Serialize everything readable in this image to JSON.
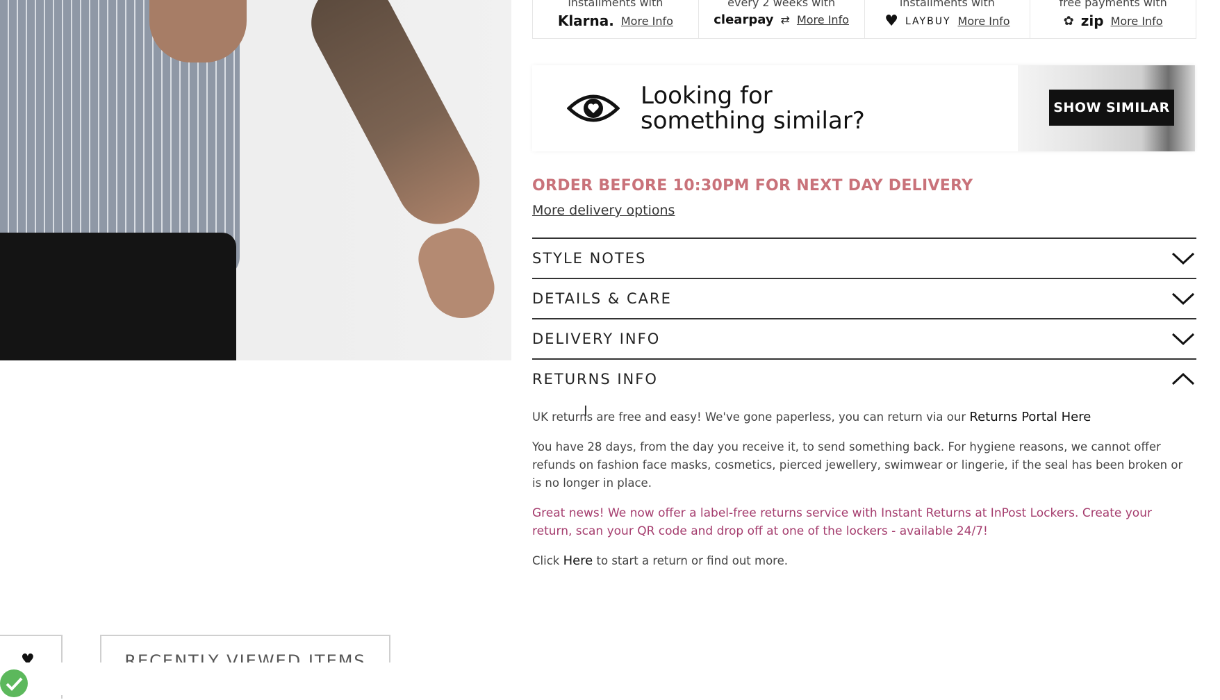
{
  "payments": [
    {
      "text": "installments with",
      "brand": "Klarna.",
      "more": "More Info"
    },
    {
      "text": "every 2 weeks with",
      "brand": "clearpay",
      "more": "More Info"
    },
    {
      "text": "installments with",
      "brand": "LAYBUY",
      "more": "More Info"
    },
    {
      "text": "free payments with",
      "brand": "zip",
      "more": "More Info"
    }
  ],
  "similar": {
    "title_line1": "Looking for",
    "title_line2": "something similar?",
    "button": "SHOW SIMILAR"
  },
  "delivery": {
    "notice": "ORDER BEFORE 10:30PM FOR NEXT DAY DELIVERY",
    "link": "More delivery options"
  },
  "accordion": [
    {
      "label": "STYLE NOTES",
      "state": "collapsed"
    },
    {
      "label": "DETAILS & CARE",
      "state": "collapsed"
    },
    {
      "label": "DELIVERY INFO",
      "state": "collapsed"
    },
    {
      "label": "RETURNS INFO",
      "state": "expanded"
    }
  ],
  "returns": {
    "p1_text": "UK returns are free and easy! We've gone paperless, you can return via our ",
    "p1_link": "Returns Portal Here",
    "p2": "You have 28 days, from the day you receive it, to send something back. For hygiene reasons, we cannot offer refunds on fashion face masks, cosmetics, pierced jewellery, swimwear or lingerie, if the seal has been broken or is no longer in place.",
    "p3": "Great news! We now offer a label-free returns service with Instant Returns at InPost Lockers. Create your return, scan your QR code and drop off at one of the lockers - available 24/7!",
    "p4_prefix": "Click ",
    "p4_link": "Here",
    "p4_suffix": " to start a return or find out more."
  },
  "bottom": {
    "recent": "RECENTLY VIEWED ITEMS"
  },
  "colors": {
    "accent_pink": "#c9727a",
    "returns_pink": "#a53d6e",
    "button_black": "#111111",
    "check_green": "#5cb85c"
  }
}
